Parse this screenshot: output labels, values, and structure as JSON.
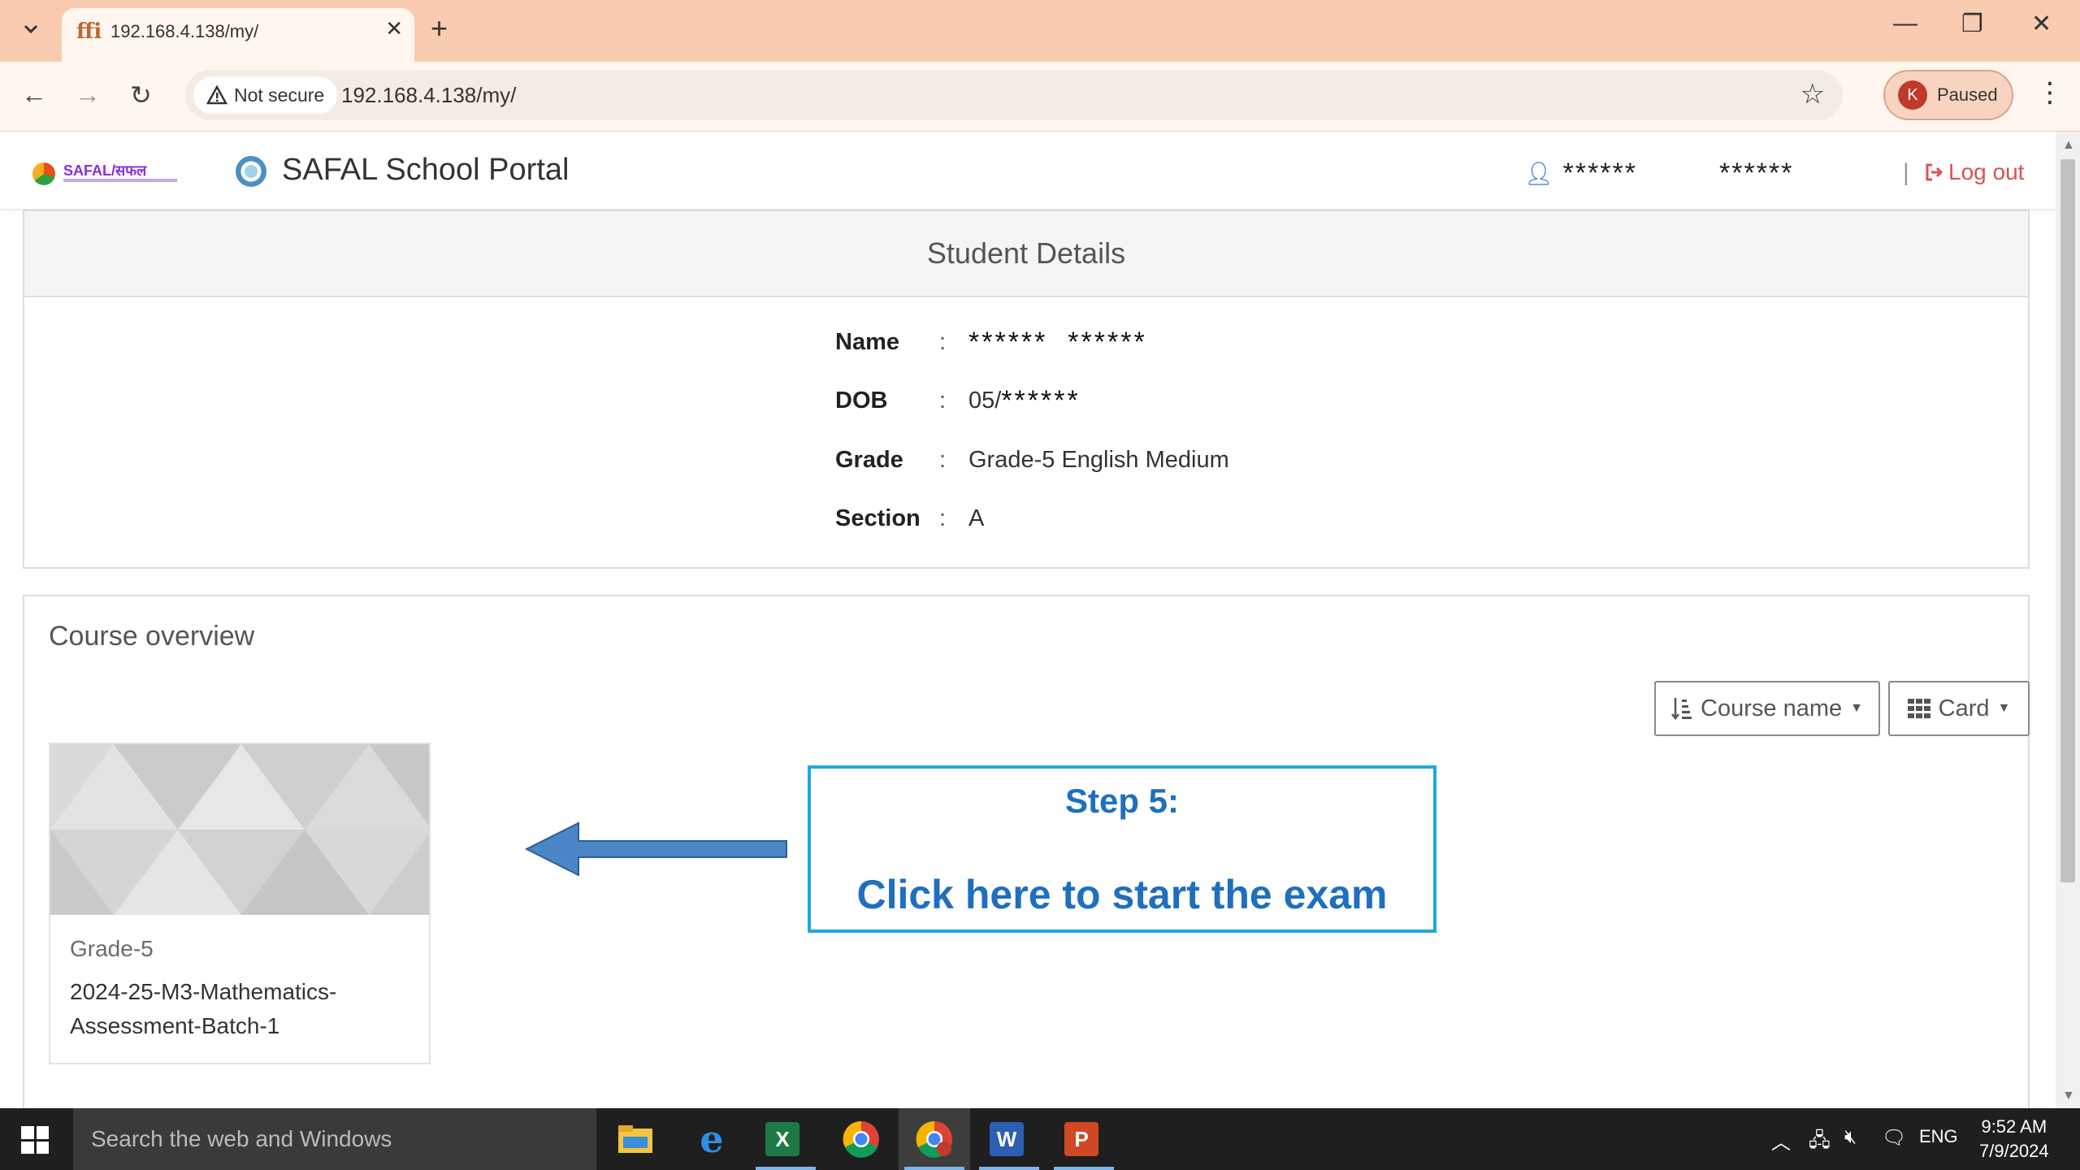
{
  "browser": {
    "tab_title": "192.168.4.138/my/",
    "tab_favicon": "ffi",
    "close_glyph": "✕",
    "new_tab_glyph": "+",
    "not_secure_label": "Not secure",
    "url": "192.168.4.138/my/",
    "profile_initial": "K",
    "profile_status": "Paused"
  },
  "header": {
    "portal_title": "SAFAL School Portal",
    "logo_text": "SAFAL/सफल",
    "user_first": "******",
    "user_last": "******",
    "separator": "|",
    "logout_label": "Log out"
  },
  "student": {
    "heading": "Student Details",
    "rows": [
      {
        "label": "Name",
        "value": "******  ******"
      },
      {
        "label": "DOB",
        "prefix": "05/",
        "value": "******"
      },
      {
        "label": "Grade",
        "value": "Grade-5 English Medium"
      },
      {
        "label": "Section",
        "value": "A"
      }
    ],
    "colon": ":"
  },
  "courses": {
    "title": "Course overview",
    "sort_label": "Course name",
    "view_label": "Card",
    "items": [
      {
        "category": "Grade-5",
        "name": "2024-25-M3-Mathematics-Assessment-Batch-1"
      }
    ]
  },
  "callout": {
    "step": "Step 5:",
    "action": "Click here to start the exam",
    "color": "#1e6fbf",
    "border_color": "#1fa9e1"
  },
  "taskbar": {
    "search_placeholder": "Search the web and Windows",
    "language": "ENG",
    "time": "9:52 AM",
    "date": "7/9/2024"
  }
}
